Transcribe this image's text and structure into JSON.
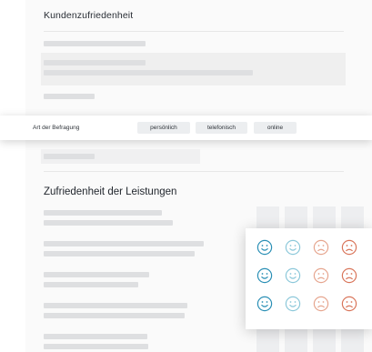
{
  "section1": {
    "title": "Kundenzufriedenheit"
  },
  "survey_type": {
    "label": "Art der Befragung",
    "options": [
      "persönlich",
      "telefonisch",
      "online"
    ]
  },
  "section2": {
    "title": "Zufriedenheit der Leistungen"
  },
  "ratings": {
    "rows": 3,
    "faces": [
      "happy",
      "happy",
      "sad",
      "sad"
    ],
    "colors": [
      "#2a8fb5",
      "#8cc8da",
      "#e6a58e",
      "#d9755a"
    ]
  }
}
